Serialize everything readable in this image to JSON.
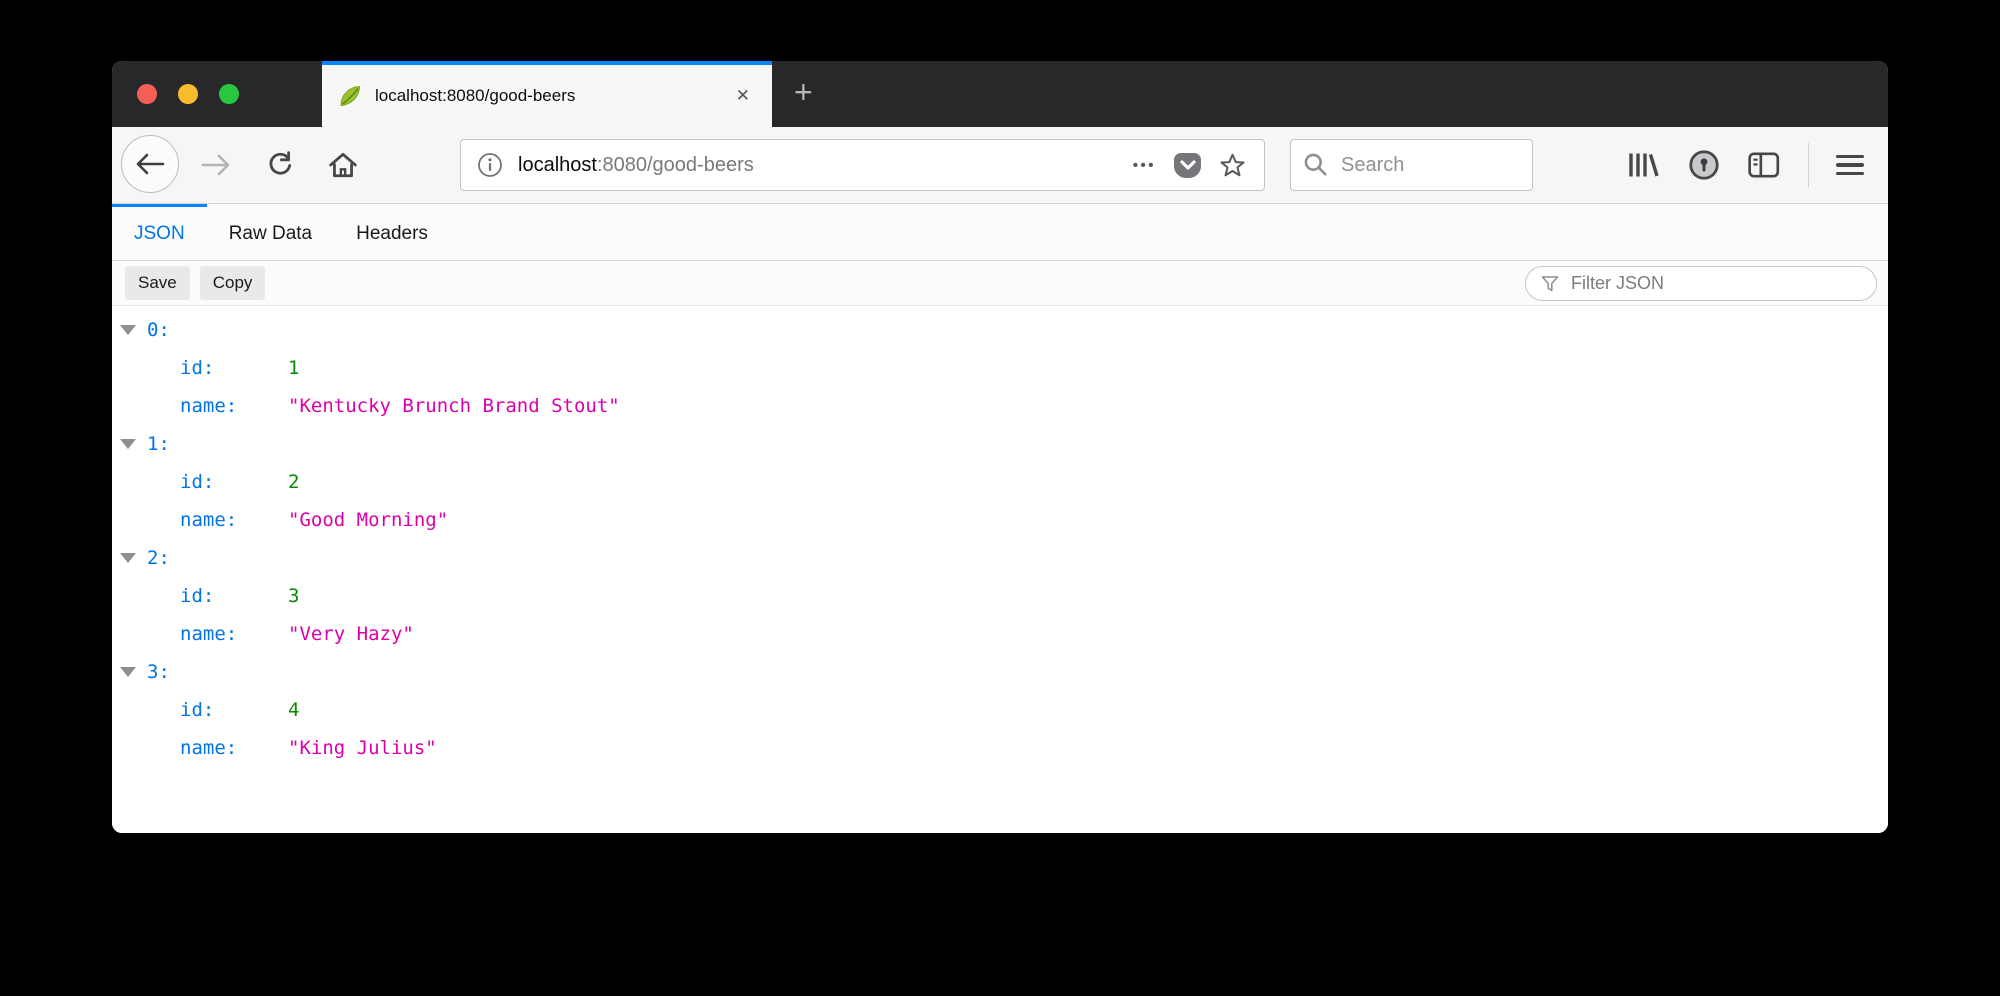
{
  "tab": {
    "title": "localhost:8080/good-beers"
  },
  "glyphs": {
    "close": "✕",
    "plus": "+",
    "ellipsis": "•••"
  },
  "toolbar": {
    "url_domain": "localhost",
    "url_path": ":8080/good-beers",
    "search_placeholder": "Search"
  },
  "viewer_tabs": {
    "json": "JSON",
    "raw": "Raw Data",
    "headers": "Headers"
  },
  "actions": {
    "save": "Save",
    "copy": "Copy",
    "filter_placeholder": "Filter JSON"
  },
  "json": {
    "key_id": "id:",
    "key_name": "name:",
    "entries": [
      {
        "index": "0:",
        "id": "1",
        "name": "\"Kentucky Brunch Brand Stout\""
      },
      {
        "index": "1:",
        "id": "2",
        "name": "\"Good Morning\""
      },
      {
        "index": "2:",
        "id": "3",
        "name": "\"Very Hazy\""
      },
      {
        "index": "3:",
        "id": "4",
        "name": "\"King Julius\""
      }
    ]
  },
  "colors": {
    "tab_accent": "#0a84ff",
    "active_viewer_tab": "#0074e8",
    "json_key": "#0074e8",
    "json_number": "#058b00",
    "json_string": "#dd00a9",
    "titlebar": "#28282b",
    "traffic_red": "#f55f57",
    "traffic_yellow": "#f9bc2e",
    "traffic_green": "#29c73f"
  }
}
